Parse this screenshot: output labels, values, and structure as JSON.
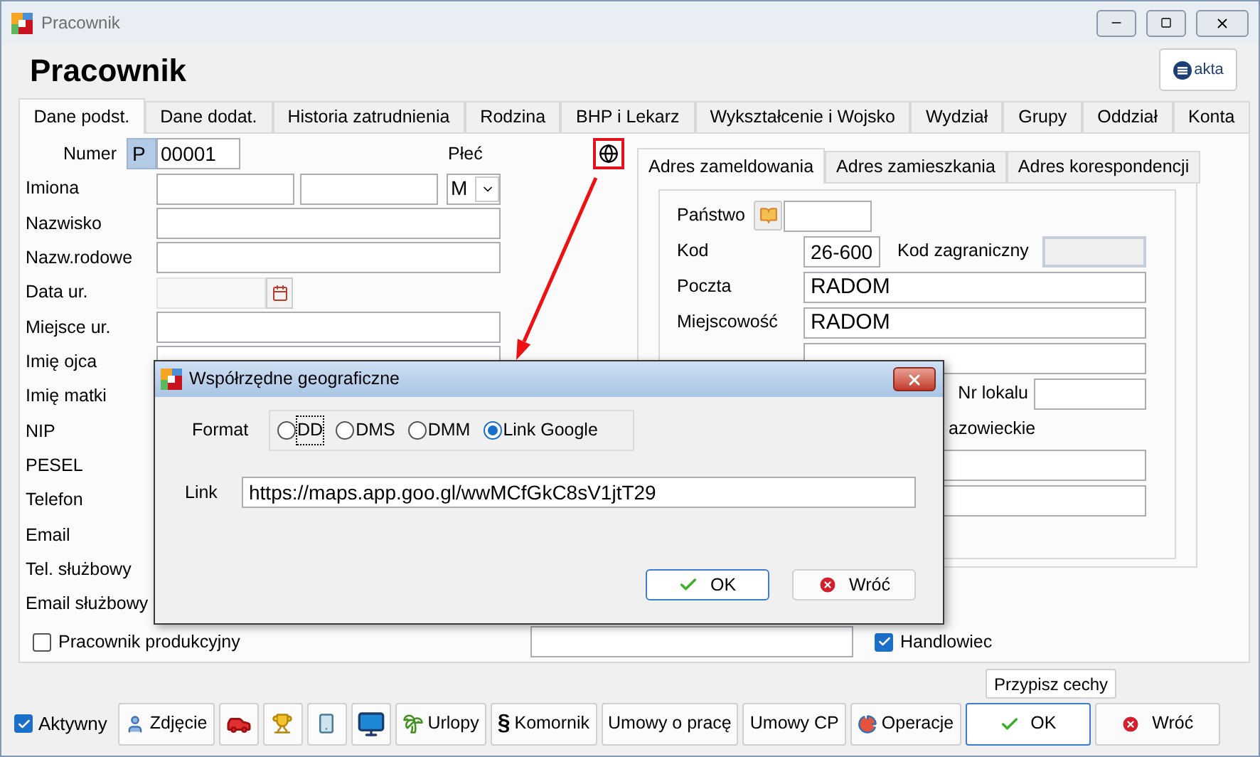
{
  "window": {
    "title": "Pracownik"
  },
  "header": {
    "title": "Pracownik",
    "logo_text": "akta"
  },
  "tabs": [
    {
      "label": "Dane podst.",
      "selected": true
    },
    {
      "label": "Dane dodat.",
      "selected": false
    },
    {
      "label": "Historia zatrudnienia",
      "selected": false
    },
    {
      "label": "Rodzina",
      "selected": false
    },
    {
      "label": "BHP i Lekarz",
      "selected": false
    },
    {
      "label": "Wykształcenie i Wojsko",
      "selected": false
    },
    {
      "label": "Wydział",
      "selected": false
    },
    {
      "label": "Grupy",
      "selected": false
    },
    {
      "label": "Oddział",
      "selected": false
    },
    {
      "label": "Konta",
      "selected": false
    }
  ],
  "form": {
    "number": {
      "label": "Numer",
      "prefix": "P",
      "value": "00001"
    },
    "gender": {
      "label": "Płeć",
      "value": "M"
    },
    "rows": [
      {
        "kind": "names",
        "label": "Imiona"
      },
      {
        "kind": "text",
        "label": "Nazwisko"
      },
      {
        "kind": "text",
        "label": "Nazw.rodowe"
      },
      {
        "kind": "date",
        "label": "Data ur."
      },
      {
        "kind": "text",
        "label": "Miejsce ur."
      },
      {
        "kind": "text",
        "label": "Imię ojca"
      },
      {
        "kind": "label",
        "label": "Imię matki"
      },
      {
        "kind": "label",
        "label": "NIP"
      },
      {
        "kind": "label",
        "label": "PESEL"
      },
      {
        "kind": "label",
        "label": "Telefon"
      },
      {
        "kind": "label",
        "label": "Email"
      },
      {
        "kind": "label",
        "label": "Tel. służbowy"
      },
      {
        "kind": "label",
        "label": "Email służbowy"
      }
    ]
  },
  "address": {
    "tabs": [
      {
        "label": "Adres zameldowania",
        "selected": true
      },
      {
        "label": "Adres zamieszkania",
        "selected": false
      },
      {
        "label": "Adres korespondencji",
        "selected": false
      }
    ],
    "rows": [
      {
        "kind": "country",
        "label": "Państwo"
      },
      {
        "kind": "postcode",
        "label": "Kod",
        "value": "26-600",
        "label2": "Kod zagraniczny"
      },
      {
        "kind": "text",
        "label": "Poczta",
        "value": "RADOM"
      },
      {
        "kind": "text",
        "label": "Miejscowość",
        "value": "RADOM"
      },
      {
        "kind": "field"
      },
      {
        "kind": "unit",
        "label": "Nr lokalu"
      },
      {
        "kind": "note",
        "text": "azowieckie"
      },
      {
        "kind": "field"
      },
      {
        "kind": "field"
      }
    ]
  },
  "flags": [
    {
      "label": "Pracownik produkcyjny",
      "checked": false
    },
    {
      "label": "Handlowiec",
      "checked": true
    }
  ],
  "assign_button": "Przypisz cechy",
  "active": {
    "label": "Aktywny",
    "checked": true
  },
  "toolbar": [
    {
      "kind": "person",
      "label": "Zdjęcie"
    },
    {
      "kind": "car"
    },
    {
      "kind": "trophy"
    },
    {
      "kind": "phone"
    },
    {
      "kind": "monitor"
    },
    {
      "kind": "palm",
      "label": "Urlopy"
    },
    {
      "kind": "glyph",
      "glyph": "§",
      "label": "Komornik"
    },
    {
      "kind": "text",
      "label": "Umowy o pracę"
    },
    {
      "kind": "text",
      "label": "Umowy CP"
    },
    {
      "kind": "chart",
      "label": "Operacje"
    },
    {
      "kind": "ok",
      "label": "OK"
    },
    {
      "kind": "cancel",
      "label": "Wróć"
    }
  ],
  "dialog": {
    "title": "Współrzędne geograficzne",
    "format_label": "Format",
    "formats": [
      {
        "label": "DD",
        "selected": false,
        "focused": true
      },
      {
        "label": "DMS",
        "selected": false,
        "focused": false
      },
      {
        "label": "DMM",
        "selected": false,
        "focused": false
      },
      {
        "label": "Link Google",
        "selected": true,
        "focused": false
      }
    ],
    "link_label": "Link",
    "link": "https://maps.app.goo.gl/wwMCfGkC8sV1jtT29",
    "buttons": [
      {
        "kind": "ok",
        "label": "OK"
      },
      {
        "kind": "cancel",
        "label": "Wróć"
      }
    ]
  }
}
